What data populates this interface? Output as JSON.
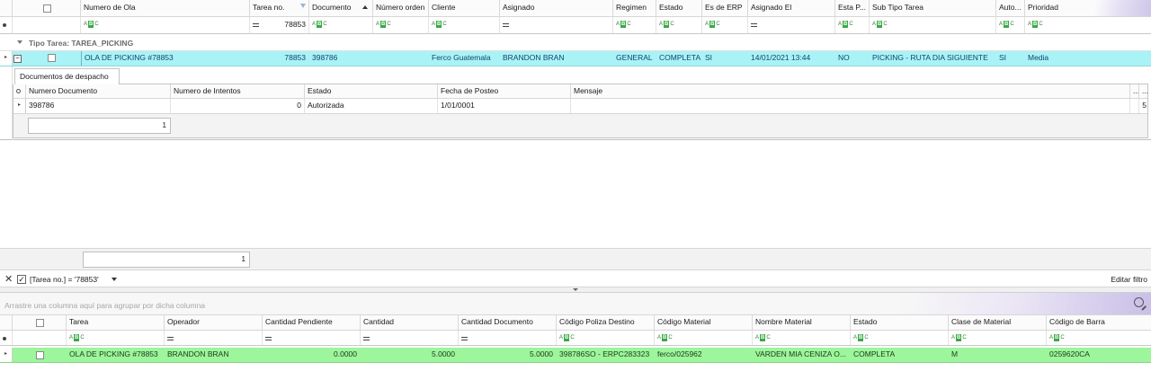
{
  "top_grid": {
    "columns": [
      {
        "label": "Numero de Ola",
        "filter": "abc"
      },
      {
        "label": "Tarea no.",
        "filter_icon": "funnel-icon",
        "filter": "eq",
        "filter_value": "78853"
      },
      {
        "label": "Documento",
        "sort_icon": "sort-asc-icon",
        "filter": "abc"
      },
      {
        "label": "Número orden",
        "filter": "abc"
      },
      {
        "label": "Cliente",
        "filter": "abc"
      },
      {
        "label": "Asignado",
        "filter": "eq"
      },
      {
        "label": "Regimen",
        "filter": "abc"
      },
      {
        "label": "Estado",
        "filter": "abc"
      },
      {
        "label": "Es de ERP",
        "filter": "abc"
      },
      {
        "label": "Asignado El",
        "filter": "eq"
      },
      {
        "label": "Esta P...",
        "filter": "abc"
      },
      {
        "label": "Sub Tipo Tarea",
        "filter": "abc"
      },
      {
        "label": "Auto...",
        "filter": "abc"
      },
      {
        "label": "Prioridad",
        "filter": "abc"
      }
    ],
    "group_label": "Tipo Tarea: TAREA_PICKING",
    "row": {
      "numero_de_ola": "OLA DE PICKING #78853",
      "tarea_no": "78853",
      "documento": "398786",
      "numero_orden": "",
      "cliente": "Ferco Guatemala",
      "asignado": "BRANDON BRAN",
      "regimen": "GENERAL",
      "estado": "COMPLETA",
      "es_de_erp": "SI",
      "asignado_el": "14/01/2021 13:44",
      "esta_p": "NO",
      "sub_tipo_tarea": "PICKING - RUTA DIA SIGUIENTE",
      "auto": "SI",
      "prioridad": "Media"
    },
    "footer_count": "1",
    "colors": {
      "selected_row": "#a9f3f6",
      "group_text": "#6b6b6b"
    }
  },
  "detail": {
    "tab_label": "Documentos de despacho",
    "columns": [
      "Numero Documento",
      "Numero de Intentos",
      "Estado",
      "Fecha de Posteo",
      "Mensaje",
      "...",
      "..."
    ],
    "row": {
      "numero_documento": "398786",
      "numero_intentos": "0",
      "estado": "Autorizada",
      "fecha_posteo": "1/01/0001",
      "mensaje": "",
      "last": "5"
    },
    "footer_count": "1"
  },
  "filter_bar": {
    "close_icon": "close-icon",
    "checked": true,
    "expression": "[Tarea no.] = '78853'",
    "edit_label": "Editar filtro"
  },
  "bottom_grid": {
    "group_panel_text": "Arrastre una columna aquí para agrupar por dicha columna",
    "columns": [
      {
        "label": "Tarea",
        "filter": "abc"
      },
      {
        "label": "Operador",
        "filter": "eq"
      },
      {
        "label": "Cantidad Pendiente",
        "filter": "eq"
      },
      {
        "label": "Cantidad",
        "filter": "eq"
      },
      {
        "label": "Cantidad Documento",
        "filter": "eq"
      },
      {
        "label": "Código Poliza Destino",
        "filter": "abc"
      },
      {
        "label": "Código Material",
        "filter": "abc"
      },
      {
        "label": "Nombre Material",
        "filter": "abc"
      },
      {
        "label": "Estado",
        "filter": "abc"
      },
      {
        "label": "Clase de Material",
        "filter": "abc"
      },
      {
        "label": "Código de Barra",
        "filter": "abc"
      }
    ],
    "row": {
      "tarea": "OLA DE PICKING #78853",
      "operador": "BRANDON BRAN",
      "cantidad_pendiente": "0.0000",
      "cantidad": "5.0000",
      "cantidad_documento": "5.0000",
      "codigo_poliza_destino": "398786SO - ERPC283323",
      "codigo_material": "ferco/025962",
      "nombre_material": "VARDEN MIA CENIZA O...",
      "estado": "COMPLETA",
      "clase_material": "M",
      "codigo_barra": "0259620CA"
    },
    "colors": {
      "row": "#9df59c"
    }
  }
}
